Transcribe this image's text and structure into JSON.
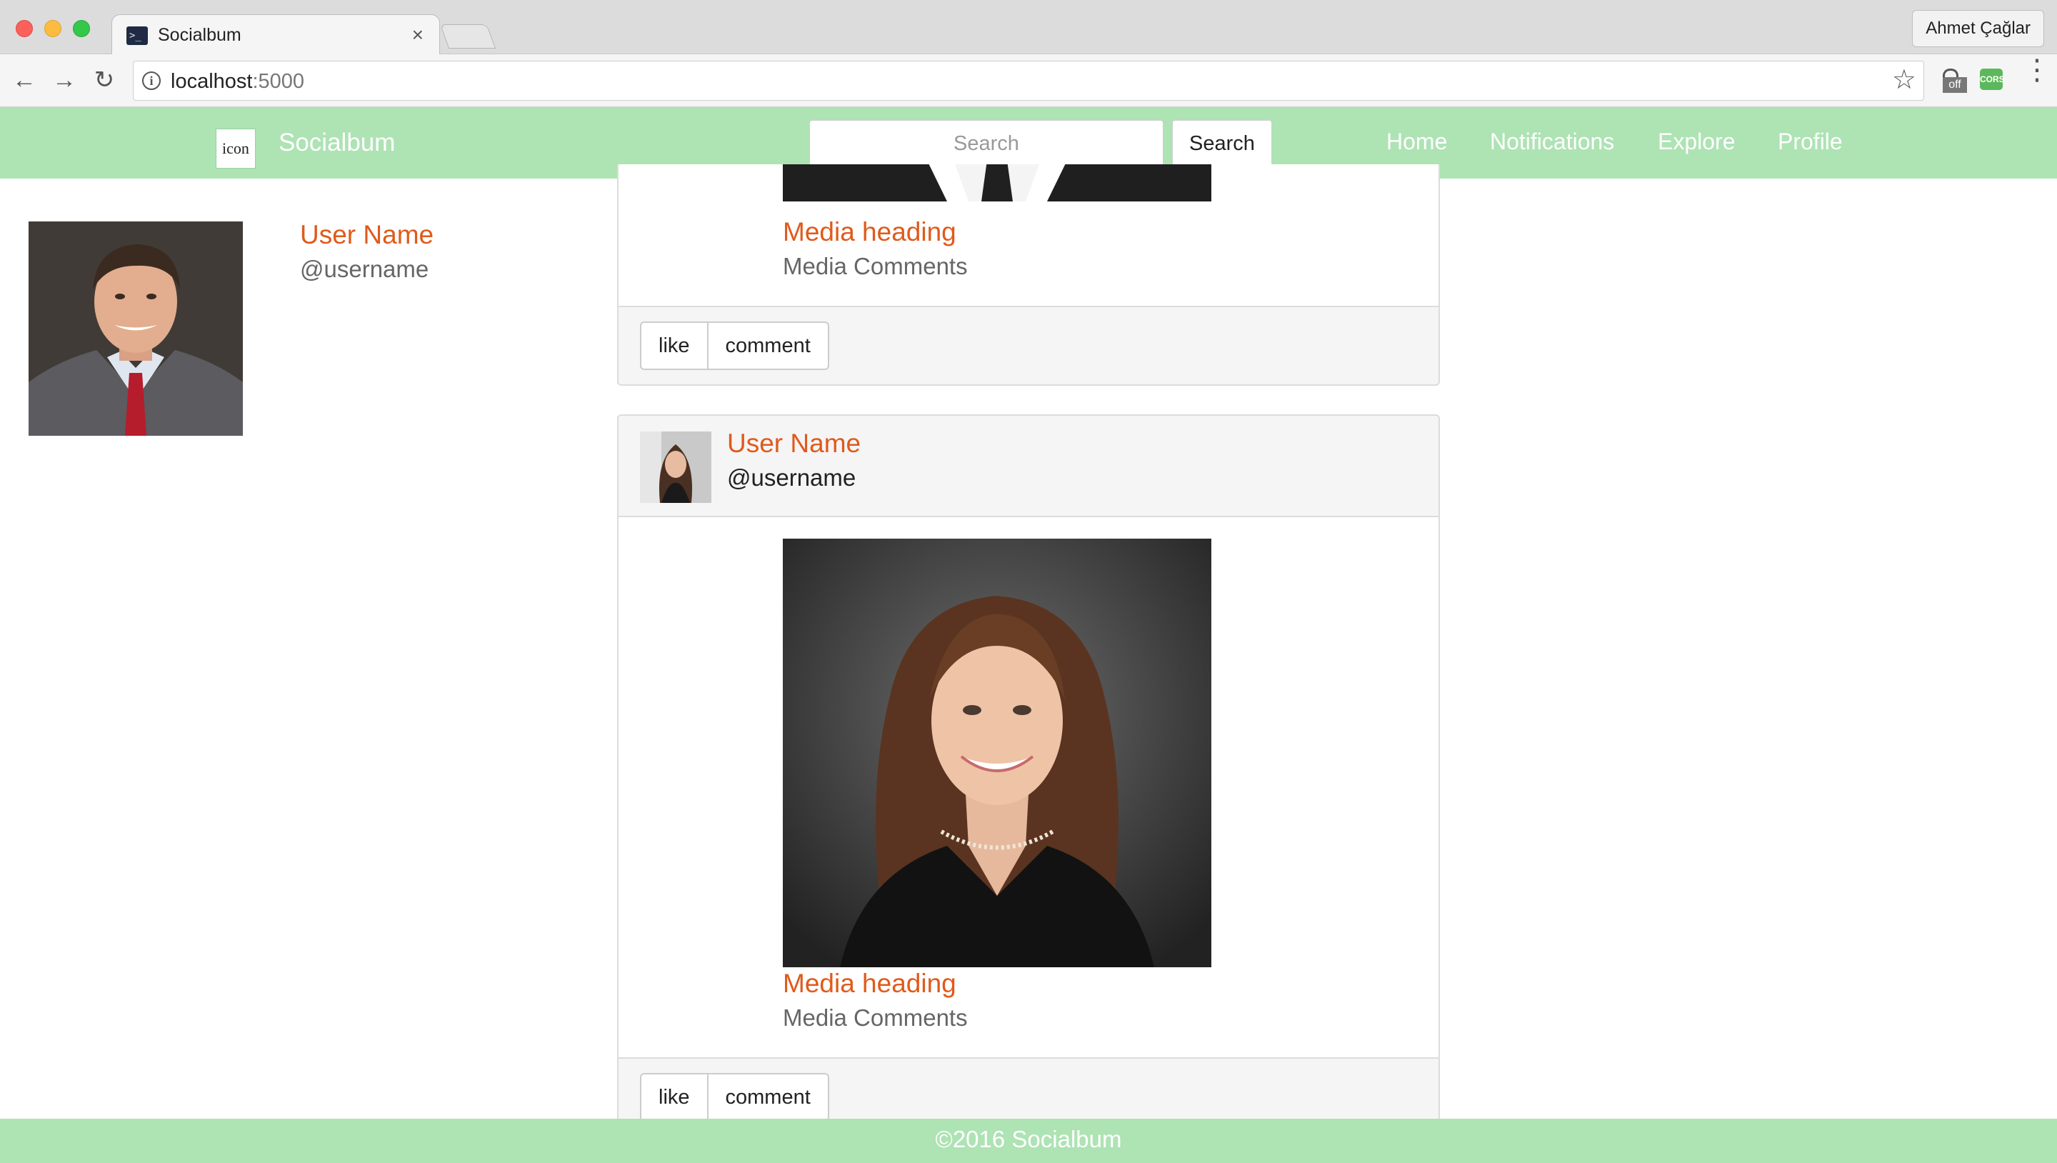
{
  "browser": {
    "tab_title": "Socialbum",
    "tab_close": "×",
    "favicon_text": ">_",
    "profile_name": "Ahmet Çağlar",
    "url_host": "localhost",
    "url_port": ":5000",
    "ext_tag": "off",
    "ext_cors": "CORS",
    "icons": {
      "back": "arrow-left",
      "forward": "arrow-right",
      "reload": "reload",
      "info": "info",
      "star": "star",
      "menu": "vertical-dots"
    }
  },
  "navbar": {
    "logo_text": "icon",
    "brand": "Socialbum",
    "search_placeholder": "Search",
    "search_button": "Search",
    "links": [
      "Home",
      "Notifications",
      "Explore",
      "Profile"
    ],
    "background_color": "#aee3b4"
  },
  "profile": {
    "name": "User Name",
    "handle": "@username"
  },
  "posts": [
    {
      "media_heading": "Media heading",
      "media_comments": "Media Comments",
      "actions": [
        "like",
        "comment"
      ]
    },
    {
      "user_name": "User Name",
      "user_handle": "@username",
      "media_heading": "Media heading",
      "media_comments": "Media Comments",
      "actions": [
        "like",
        "comment"
      ]
    }
  ],
  "footer": {
    "text": "©2016 Socialbum"
  },
  "colors": {
    "accent": "#e05a1b",
    "panel": "#f5f5f5"
  }
}
